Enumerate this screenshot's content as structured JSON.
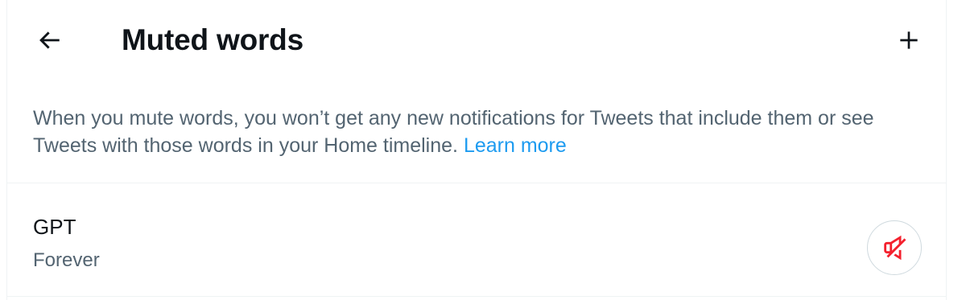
{
  "header": {
    "title": "Muted words",
    "back_icon": "arrow-left-icon",
    "add_icon": "plus-icon"
  },
  "description": {
    "text": "When you mute words, you won’t get any new notifications for Tweets that include them or see Tweets with those words in your Home timeline. ",
    "link_text": "Learn more"
  },
  "muted_words": [
    {
      "word": "GPT",
      "duration": "Forever",
      "action_icon": "speaker-muted-icon"
    }
  ],
  "colors": {
    "text_primary": "#0f1419",
    "text_secondary": "#536471",
    "link": "#1d9bf0",
    "mute_icon": "#f4212e",
    "border": "#eff3f4"
  }
}
